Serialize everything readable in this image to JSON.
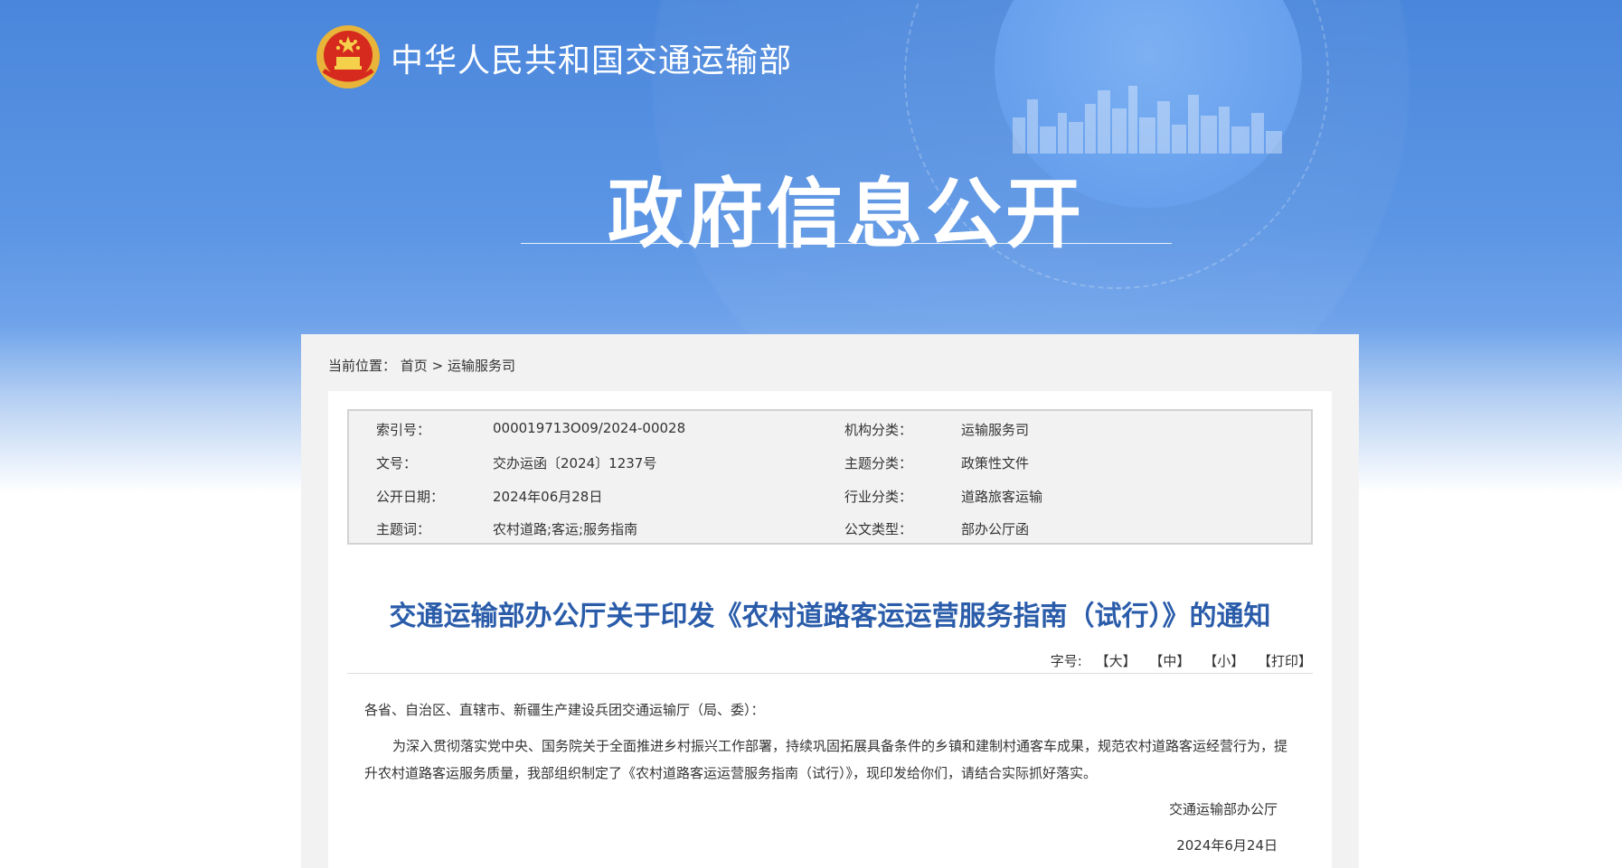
{
  "header": {
    "site_name": "中华人民共和国交通运输部",
    "page_heading": "政府信息公开"
  },
  "breadcrumb": {
    "prefix": "当前位置：",
    "home": "首页",
    "separator": ">",
    "current": "运输服务司"
  },
  "meta": {
    "index_no_label": "索引号：",
    "index_no": "000019713O09/2024-00028",
    "org_label": "机构分类：",
    "org": "运输服务司",
    "doc_no_label": "文号：",
    "doc_no": "交办运函〔2024〕1237号",
    "topic_label": "主题分类：",
    "topic": "政策性文件",
    "pub_date_label": "公开日期：",
    "pub_date": "2024年06月28日",
    "industry_label": "行业分类：",
    "industry": "道路旅客运输",
    "keywords_label": "主题词：",
    "keywords": "农村道路;客运;服务指南",
    "doc_type_label": "公文类型：",
    "doc_type": "部办公厅函"
  },
  "article": {
    "title": "交通运输部办公厅关于印发《农村道路客运运营服务指南（试行）》的通知",
    "font_size_label": "字号:",
    "font_large": "【大】",
    "font_medium": "【中】",
    "font_small": "【小】",
    "print": "【打印】",
    "salutation": "各省、自治区、直辖市、新疆生产建设兵团交通运输厅（局、委）：",
    "paragraph": "为深入贯彻落实党中央、国务院关于全面推进乡村振兴工作部署，持续巩固拓展具备条件的乡镇和建制村通客车成果，规范农村道路客运经营行为，提升农村道路客运服务质量，我部组织制定了《农村道路客运运营服务指南（试行）》，现印发给你们，请结合实际抓好落实。",
    "signer": "交通运输部办公厅",
    "sign_date": "2024年6月24日"
  },
  "colors": {
    "hero_blue": "#4a86db",
    "title_blue": "#2a5caa",
    "panel_gray": "#f2f2f2"
  }
}
